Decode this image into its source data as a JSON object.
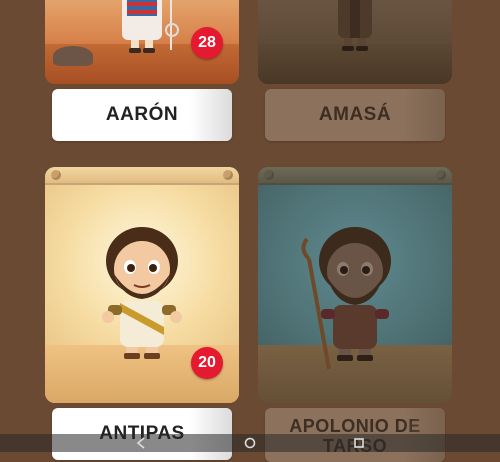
{
  "characters": [
    {
      "name": "AARÓN",
      "badge": "28",
      "locked": false
    },
    {
      "name": "AMASÁ",
      "badge": "",
      "locked": true
    },
    {
      "name": "ANTIPAS",
      "badge": "20",
      "locked": false
    },
    {
      "name": "APOLONIO DE TARSO",
      "badge": "",
      "locked": true
    }
  ],
  "colors": {
    "badge": "#e5192f",
    "background": "#6b4a33"
  },
  "icons": {
    "nav_back": "triangle-back-icon",
    "nav_home": "circle-home-icon",
    "nav_recent": "square-recent-icon"
  }
}
